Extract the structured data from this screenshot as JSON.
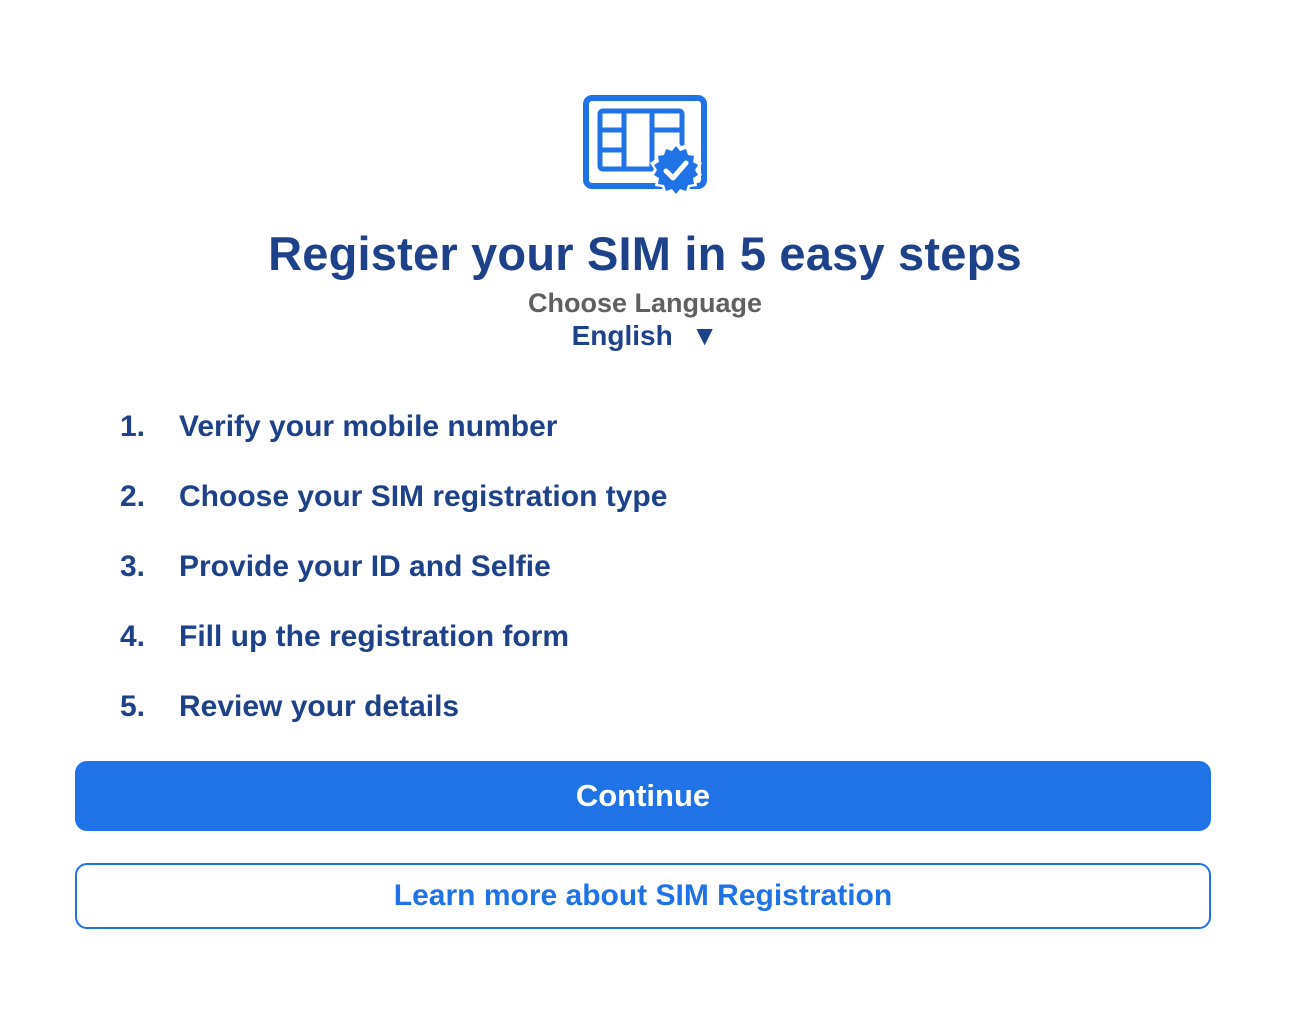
{
  "header": {
    "icon": "sim-card-verified-icon",
    "title": "Register your SIM in 5 easy steps"
  },
  "language": {
    "label": "Choose Language",
    "selected": "English",
    "caret": "▼"
  },
  "steps": [
    {
      "num": "1.",
      "text": "Verify your mobile number"
    },
    {
      "num": "2.",
      "text": "Choose your SIM registration type"
    },
    {
      "num": "3.",
      "text": "Provide your ID and Selfie"
    },
    {
      "num": "4.",
      "text": "Fill up the registration form"
    },
    {
      "num": "5.",
      "text": "Review your details"
    }
  ],
  "actions": {
    "continue_label": "Continue",
    "learn_more_label": "Learn more about SIM Registration"
  },
  "colors": {
    "primary": "#1f73e6",
    "heading": "#1d4289",
    "muted": "#606060"
  }
}
